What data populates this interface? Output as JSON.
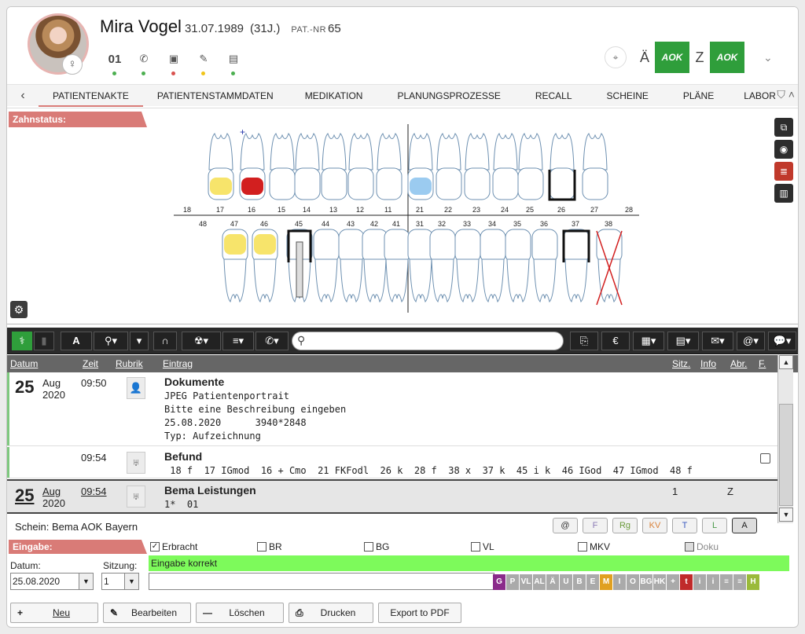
{
  "patient": {
    "name": "Mira Vogel",
    "dob": "31.07.1989",
    "age": "(31J.)",
    "patnr_label": "PAT.-NR",
    "patnr": "65",
    "gender_symbol": "♀",
    "count": "01"
  },
  "header_icons": [
    {
      "name": "phone-icon",
      "glyph": "✆",
      "dot": "#4caf50"
    },
    {
      "name": "card-icon",
      "glyph": "▣",
      "dot": "#d9534f"
    },
    {
      "name": "pencil-icon",
      "glyph": "✎",
      "dot": "#f0c419"
    },
    {
      "name": "document-icon",
      "glyph": "▤",
      "dot": "#4caf50"
    }
  ],
  "insurance": {
    "letter_a": "Ä",
    "letter_z": "Z",
    "logo": "AOK",
    "color": "#2f9e3b"
  },
  "tabs": [
    "PATIENTENAKTE",
    "PATIENTENSTAMMDATEN",
    "MEDIKATION",
    "PLANUNGSPROZESSE",
    "RECALL",
    "SCHEINE",
    "PLÄNE",
    "LABOR"
  ],
  "zahnstatus": {
    "label": "Zahnstatus:",
    "upper_numbers": [
      "18",
      "17",
      "16",
      "15",
      "14",
      "13",
      "12",
      "11",
      "21",
      "22",
      "23",
      "24",
      "25",
      "26",
      "27",
      "28"
    ],
    "lower_numbers": [
      "48",
      "47",
      "46",
      "45",
      "44",
      "43",
      "42",
      "41",
      "31",
      "32",
      "33",
      "34",
      "35",
      "36",
      "37",
      "38"
    ],
    "marker": "+"
  },
  "list": {
    "columns": {
      "datum": "Datum",
      "zeit": "Zeit",
      "rubrik": "Rubrik",
      "eintrag": "Eintrag",
      "sitz": "Sitz.",
      "info": "Info",
      "abr": "Abr.",
      "f": "F."
    },
    "rows": [
      {
        "day": "25",
        "month": "Aug",
        "year": "2020",
        "time": "09:50",
        "title": "Dokumente",
        "lines": [
          "JPEG Patientenportrait",
          "Bitte eine Beschreibung eingeben",
          "25.08.2020      3940*2848",
          "Typ: Aufzeichnung"
        ]
      },
      {
        "day": "",
        "month": "",
        "year": "",
        "time": "09:54",
        "title": "Befund",
        "lines": [
          " 18 f  17 IGmod  16 + Cmo  21 FKFodl  26 k  28 f  38 x  37 k  45 i k  46 IGod  47 IGmod  48 f"
        ]
      },
      {
        "day": "25",
        "month": "Aug",
        "year": "2020",
        "time": "09:54",
        "title": "Bema Leistungen",
        "lines": [
          "1*  01"
        ],
        "sitz": "1",
        "abr": "Z"
      }
    ]
  },
  "schein": {
    "text": "Schein: Bema AOK Bayern",
    "buttons": [
      {
        "label": "@",
        "color": "#333"
      },
      {
        "label": "F",
        "color": "#8a7ab5"
      },
      {
        "label": "Rg",
        "color": "#6a9a3a"
      },
      {
        "label": "KV",
        "color": "#d9823a"
      },
      {
        "label": "T",
        "color": "#3a5ac0"
      },
      {
        "label": "L",
        "color": "#4a9a4a"
      },
      {
        "label": "A",
        "color": "#222"
      }
    ]
  },
  "eingabe": {
    "label": "Eingabe:",
    "checkboxes": [
      {
        "label": "Erbracht",
        "checked": true
      },
      {
        "label": "BR",
        "checked": false
      },
      {
        "label": "BG",
        "checked": false
      },
      {
        "label": "VL",
        "checked": false
      },
      {
        "label": "MKV",
        "checked": false
      },
      {
        "label": "Doku",
        "checked": false
      }
    ],
    "datum_label": "Datum:",
    "datum_value": "25.08.2020",
    "sitzung_label": "Sitzung:",
    "sitzung_value": "1",
    "status": "Eingabe korrekt",
    "input_value": ""
  },
  "codebar": [
    {
      "t": "G",
      "c": "#8a2a8a"
    },
    {
      "t": "P",
      "c": "#aaa"
    },
    {
      "t": "VL",
      "c": "#aaa"
    },
    {
      "t": "AL",
      "c": "#aaa"
    },
    {
      "t": "Ä",
      "c": "#aaa"
    },
    {
      "t": "U",
      "c": "#aaa"
    },
    {
      "t": "B",
      "c": "#aaa"
    },
    {
      "t": "E",
      "c": "#aaa"
    },
    {
      "t": "M",
      "c": "#e0a020"
    },
    {
      "t": "I",
      "c": "#aaa"
    },
    {
      "t": "O",
      "c": "#aaa"
    },
    {
      "t": "BG",
      "c": "#aaa"
    },
    {
      "t": "HK",
      "c": "#aaa"
    },
    {
      "t": "+",
      "c": "#aaa"
    },
    {
      "t": "t",
      "c": "#c02a2a"
    },
    {
      "t": "i",
      "c": "#aaa"
    },
    {
      "t": "i",
      "c": "#aaa"
    },
    {
      "t": "≡",
      "c": "#aaa"
    },
    {
      "t": "≡",
      "c": "#aaa"
    },
    {
      "t": "H",
      "c": "#9aba3a"
    }
  ],
  "buttons": {
    "neu": "Neu",
    "bearbeiten": "Bearbeiten",
    "loeschen": "Löschen",
    "drucken": "Drucken",
    "export": "Export to PDF"
  }
}
